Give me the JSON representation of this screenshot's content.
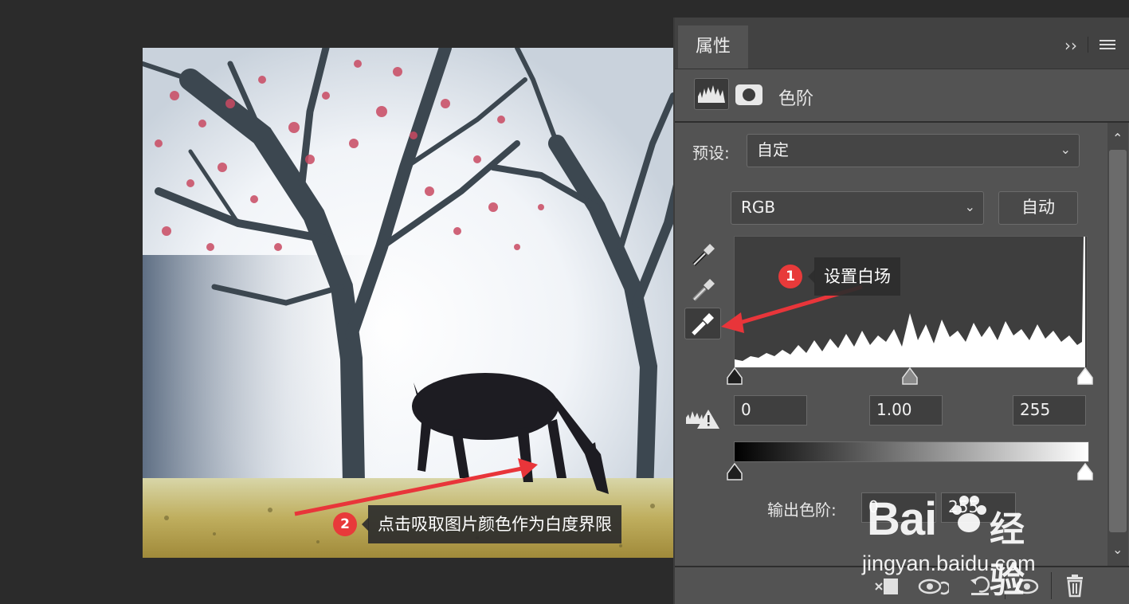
{
  "panel": {
    "tab_label": "属性",
    "expand_icon": "double-chevron-right-icon",
    "menu_icon": "hamburger-menu-icon",
    "adjustment_title": "色阶",
    "preset_label": "预设:",
    "preset_value": "自定",
    "channel_value": "RGB",
    "auto_button": "自动",
    "input_levels": {
      "black": "0",
      "gamma": "1.00",
      "white": "255"
    },
    "output_label": "输出色阶:",
    "output_levels": {
      "black": "0",
      "white": "255"
    }
  },
  "callouts": [
    {
      "number": "1",
      "text": "设置白场"
    },
    {
      "number": "2",
      "text": "点击吸取图片颜色作为白度界限"
    }
  ],
  "watermark": {
    "logo_text": "Bai",
    "logo_suffix": "经验",
    "url": "jingyan.baidu.com"
  },
  "colors": {
    "panel_bg": "#535353",
    "canvas_bg": "#2b2b2b",
    "callout_badge": "#e83a3a",
    "arrow": "#e8353a"
  }
}
